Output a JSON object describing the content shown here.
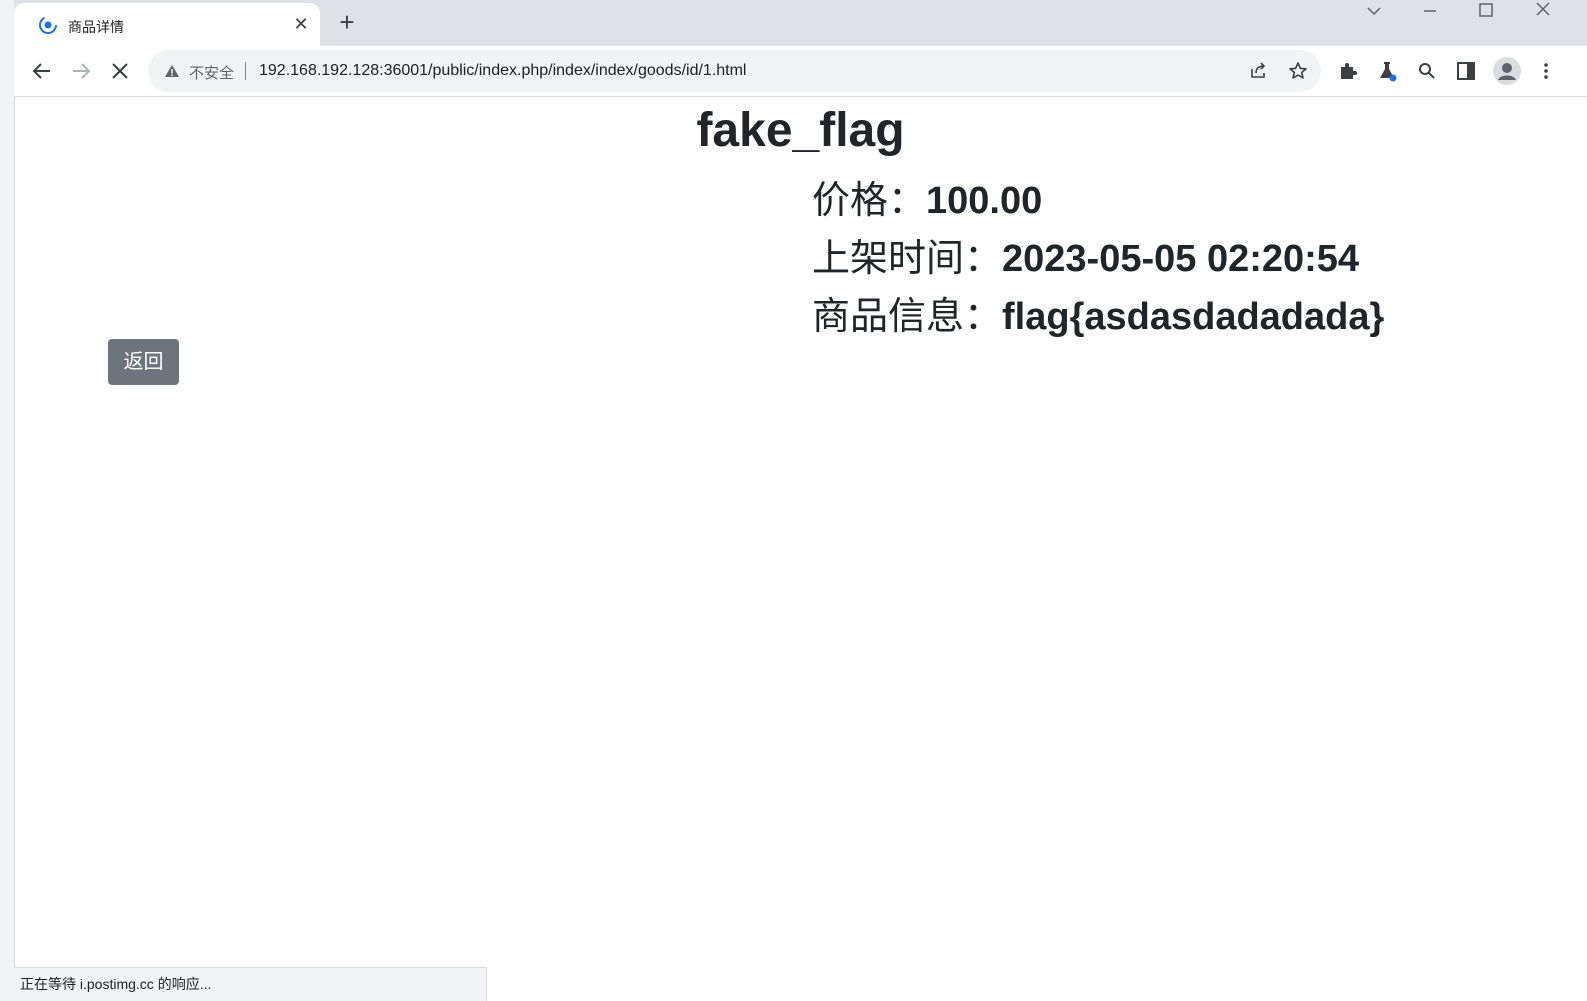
{
  "browser": {
    "tab": {
      "title": "商品详情",
      "favicon": "loading-spinner-icon"
    },
    "new_tab_icon": "plus-icon",
    "window_controls": [
      "chevron-down-icon",
      "minimize-icon",
      "maximize-icon",
      "close-icon"
    ],
    "omnibox": {
      "security_label": "不安全",
      "url": "192.168.192.128:36001/public/index.php/index/index/goods/id/1.html"
    },
    "status_text": "正在等待 i.postimg.cc 的响应..."
  },
  "page": {
    "title": "fake_flag",
    "price_label": "价格：",
    "price_value": "100.00",
    "listed_label": "上架时间：",
    "listed_value": "2023-05-05 02:20:54",
    "info_label": "商品信息：",
    "info_value": "flag{asdasdadadada}",
    "back_label": "返回"
  },
  "colors": {
    "button_bg": "#6c757d",
    "text": "#212529",
    "tabbar": "#dee1e6"
  }
}
